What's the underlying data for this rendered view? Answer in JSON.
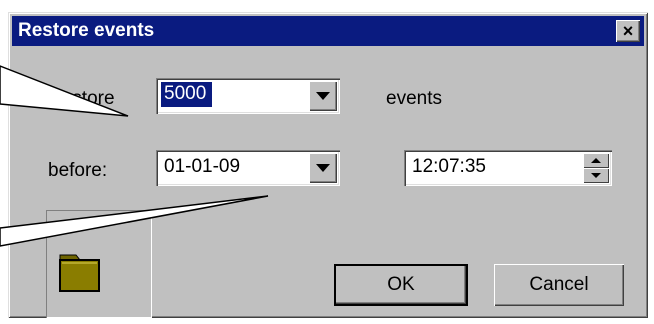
{
  "window": {
    "title": "Restore events",
    "close_glyph": "×"
  },
  "form": {
    "restore_label": "Restore",
    "count_value": "5000",
    "events_label": "events",
    "before_label": "before:",
    "date_value": "01-01-09",
    "time_value": "12:07:35"
  },
  "buttons": {
    "ok": "OK",
    "cancel": "Cancel"
  },
  "icons": {
    "folder": "folder-icon",
    "dropdown": "chevron-down-icon",
    "spin": "spin-updown-icon"
  },
  "colors": {
    "titlebar": "#0a1b80",
    "face": "#c0c0c0",
    "folder": "#8a7d00"
  }
}
